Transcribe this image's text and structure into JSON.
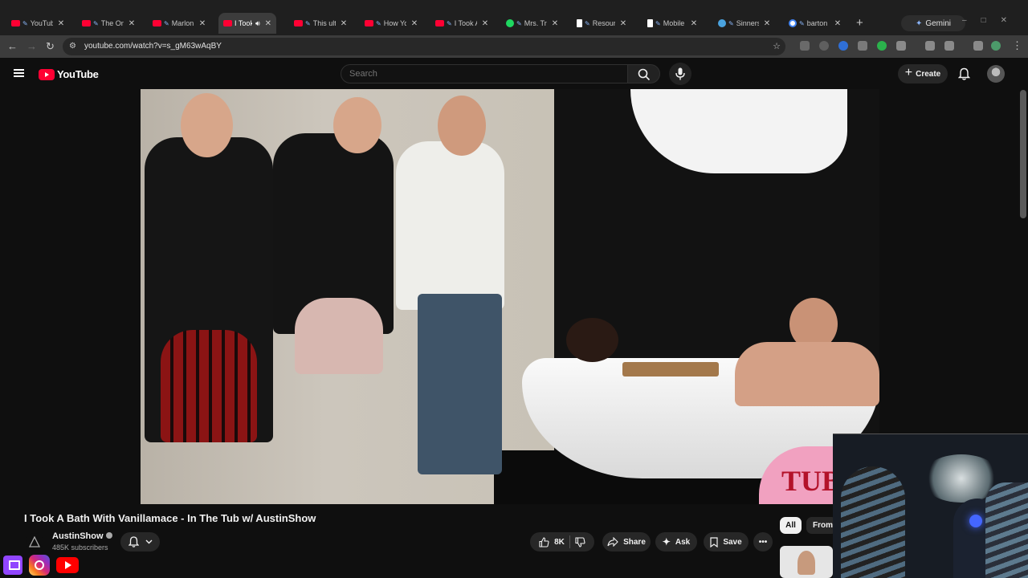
{
  "browser": {
    "tabs": [
      {
        "label": "YouTube",
        "favicon": "youtube-icon",
        "pinned": true
      },
      {
        "label": "The On",
        "favicon": "youtube-icon",
        "pinned": true
      },
      {
        "label": "Marlon",
        "favicon": "youtube-icon",
        "pinned": true
      },
      {
        "label": "I Took A",
        "favicon": "youtube-icon",
        "pinned": false,
        "active": true,
        "audio": true
      },
      {
        "label": "This ult",
        "favicon": "youtube-icon",
        "pinned": true
      },
      {
        "label": "How Yo",
        "favicon": "youtube-icon",
        "pinned": true
      },
      {
        "label": "I Took A",
        "favicon": "youtube-icon",
        "pinned": true
      },
      {
        "label": "Mrs. Tr",
        "favicon": "spotify-icon",
        "pinned": true
      },
      {
        "label": "Resour",
        "favicon": "doc-icon",
        "pinned": true
      },
      {
        "label": "Mobile",
        "favicon": "doc-icon",
        "pinned": true
      },
      {
        "label": "Sinners",
        "favicon": "sinners-icon",
        "pinned": true
      },
      {
        "label": "barton",
        "favicon": "google-icon",
        "pinned": true
      }
    ],
    "gemini_label": "Gemini",
    "url": "youtube.com/watch?v=s_gM63wAqBY"
  },
  "youtube": {
    "logo_text": "YouTube",
    "search_placeholder": "Search",
    "create_label": "Create",
    "video": {
      "title": "I Took A Bath With Vanillamace - In The Tub w/ AustinShow",
      "sign_text": "TUB"
    },
    "channel": {
      "name": "AustinShow",
      "subscribers": "485K subscribers"
    },
    "actions": {
      "likes": "8K",
      "share": "Share",
      "ask": "Ask",
      "save": "Save"
    },
    "chips": [
      "All",
      "From"
    ]
  },
  "colors": {
    "brand_red": "#ff0033",
    "background": "#0f0f0f",
    "surface": "#272727"
  }
}
